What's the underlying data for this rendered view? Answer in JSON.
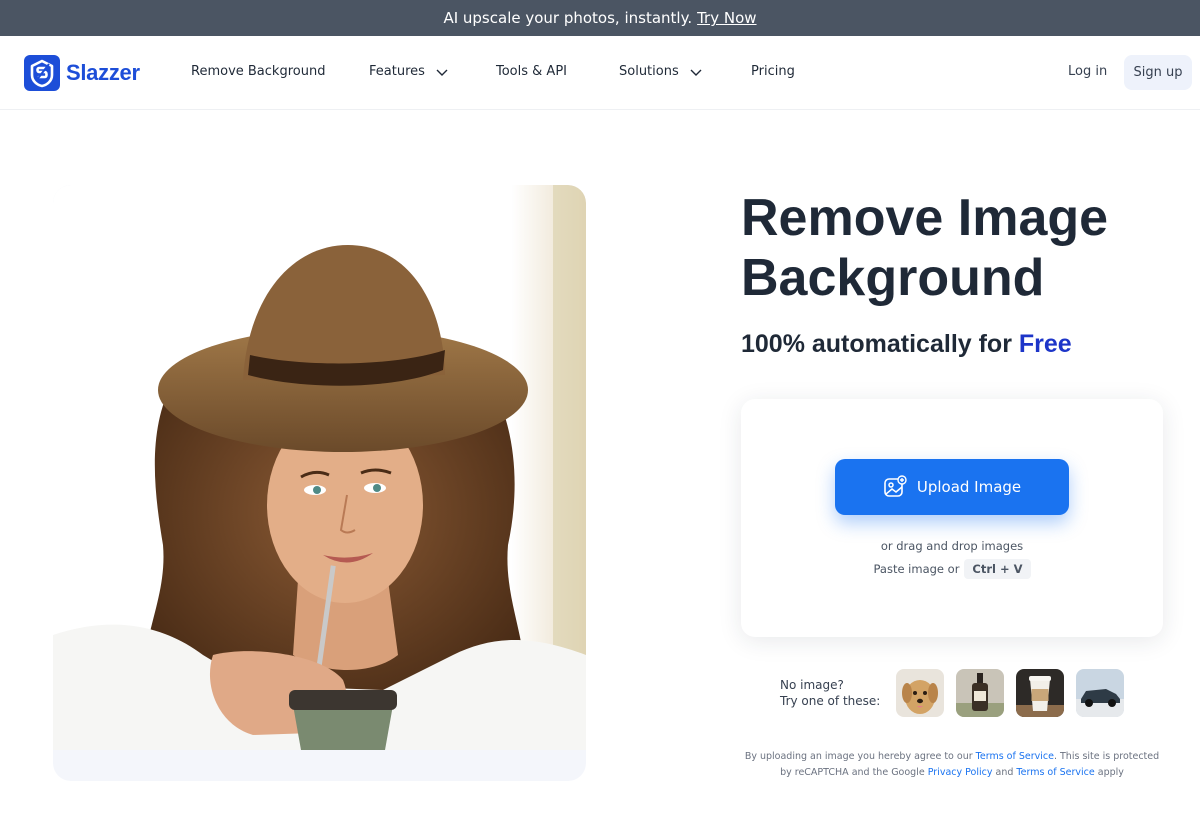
{
  "promo": {
    "text": "AI upscale your photos, instantly.",
    "link": "Try Now"
  },
  "brand": {
    "name": "Slazzer",
    "color": "#1d4ed8"
  },
  "nav": {
    "remove_background": "Remove Background",
    "features": "Features",
    "tools_api": "Tools & API",
    "solutions": "Solutions",
    "pricing": "Pricing",
    "login": "Log in",
    "signup": "Sign up"
  },
  "hero": {
    "headline": "Remove Image Background",
    "sub_prefix": "100% automatically for",
    "sub_free": "Free"
  },
  "upload": {
    "button": "Upload Image",
    "drag_text": "or drag and drop images",
    "paste_text": "Paste image or",
    "shortcut": "Ctrl + V"
  },
  "samples": {
    "line1": "No image?",
    "line2": "Try one of these:",
    "items": [
      "dog-sample",
      "bottle-sample",
      "coffee-cup-sample",
      "car-sample"
    ]
  },
  "legal": {
    "p1": "By uploading an image you hereby agree to our",
    "tos": "Terms of Service",
    "p2": ". This site is protected by reCAPTCHA and the Google",
    "privacy": "Privacy Policy",
    "and": "and",
    "tos2": "Terms of Service",
    "apply": "apply"
  },
  "colors": {
    "accent": "#1a73f0",
    "free": "#1d35c8",
    "promo_bg": "#4b5563"
  }
}
